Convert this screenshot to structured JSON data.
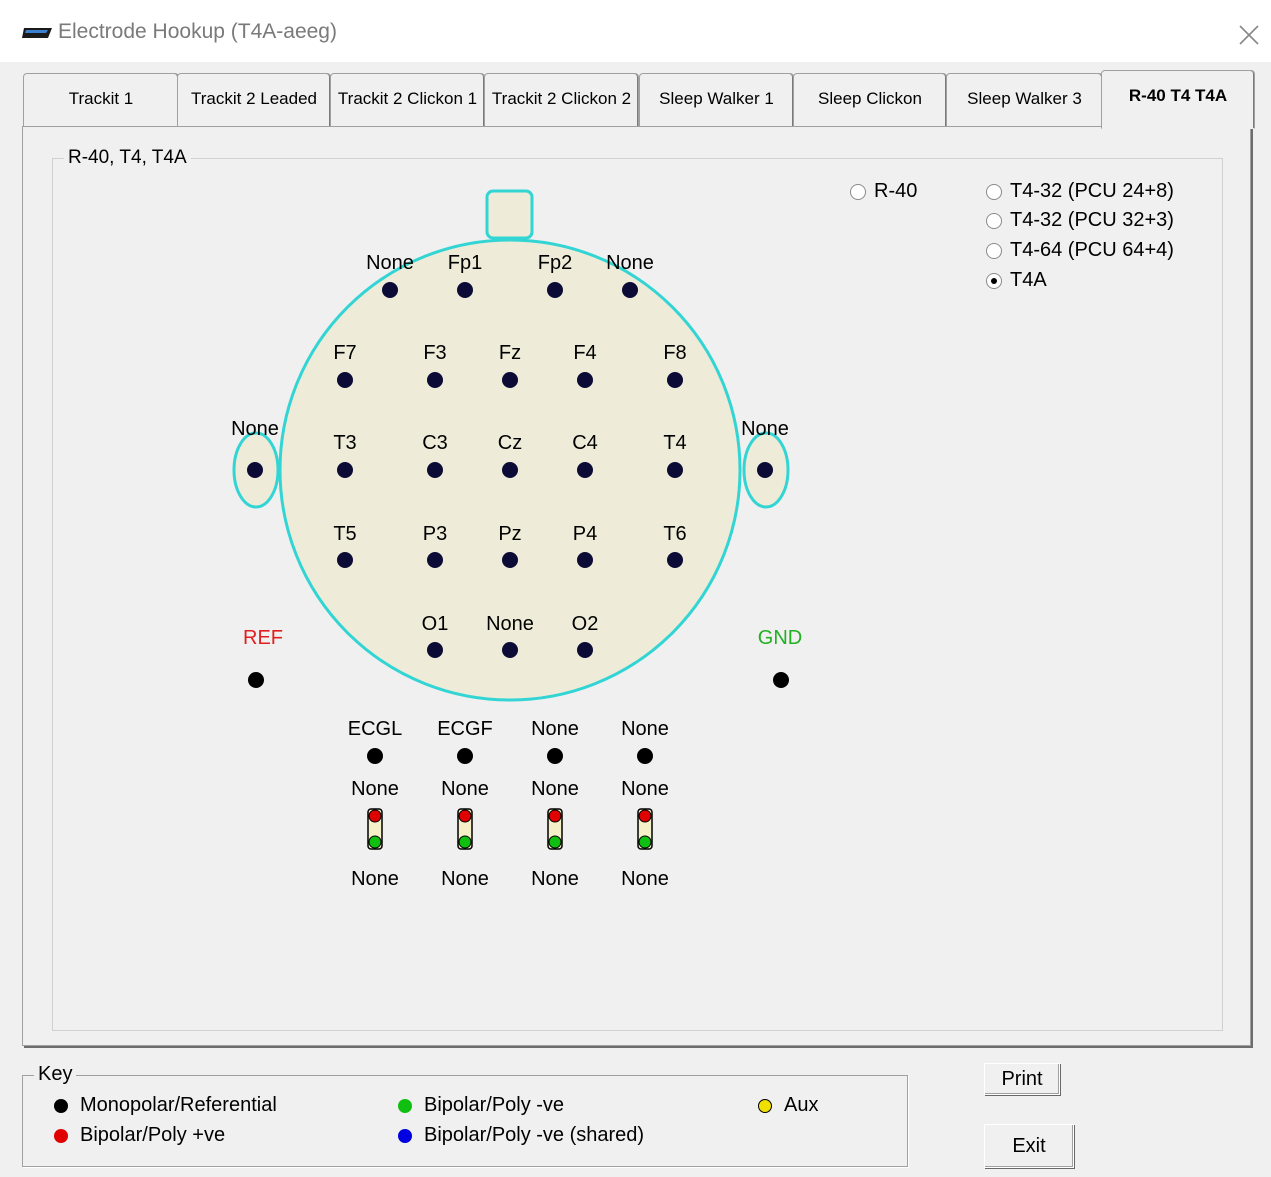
{
  "window": {
    "title": "Electrode Hookup (T4A-aeeg)",
    "icon": "device-icon",
    "close_icon": "close-icon"
  },
  "tabs": [
    {
      "label": "Trackit 1"
    },
    {
      "label": "Trackit 2 Leaded"
    },
    {
      "label": "Trackit 2 Clickon 1"
    },
    {
      "label": "Trackit 2 Clickon 2"
    },
    {
      "label": "Sleep Walker 1"
    },
    {
      "label": "Sleep Clickon"
    },
    {
      "label": "Sleep Walker 3"
    },
    {
      "label": "R-40 T4 T4A",
      "active": true
    }
  ],
  "group": {
    "title": "R-40, T4, T4A"
  },
  "options": [
    {
      "label": "R-40",
      "selected": false
    },
    {
      "label": "T4-32 (PCU 24+8)",
      "selected": false
    },
    {
      "label": "T4-32 (PCU 32+3)",
      "selected": false
    },
    {
      "label": "T4-64 (PCU 64+4)",
      "selected": false
    },
    {
      "label": "T4A",
      "selected": true
    }
  ],
  "electrodes": {
    "row1": [
      "None",
      "Fp1",
      "Fp2",
      "None"
    ],
    "row2": [
      "F7",
      "F3",
      "Fz",
      "F4",
      "F8"
    ],
    "row3": [
      "None",
      "T3",
      "C3",
      "Cz",
      "C4",
      "T4",
      "None"
    ],
    "row4": [
      "T5",
      "P3",
      "Pz",
      "P4",
      "T6"
    ],
    "row5": [
      "O1",
      "None",
      "O2"
    ],
    "ref": "REF",
    "gnd": "GND"
  },
  "aux_channels": {
    "top_labels": [
      "ECGL",
      "ECGF",
      "None",
      "None"
    ],
    "mid_labels": [
      "None",
      "None",
      "None",
      "None"
    ],
    "bottom_labels": [
      "None",
      "None",
      "None",
      "None"
    ]
  },
  "colors": {
    "head_fill": "#eeecd9",
    "head_outline": "#33d4d4",
    "ref": "#e02020",
    "gnd": "#22b022",
    "monopolar": "#000000",
    "bipolar_pos": "#e00000",
    "bipolar_neg": "#10c010",
    "bipolar_shared": "#0000e0",
    "aux": "#f0e000"
  },
  "key": {
    "title": "Key",
    "items": [
      {
        "label": "Monopolar/Referential",
        "color": "#000000"
      },
      {
        "label": "Bipolar/Poly +ve",
        "color": "#e00000"
      },
      {
        "label": "Bipolar/Poly -ve",
        "color": "#10c010"
      },
      {
        "label": "Bipolar/Poly -ve (shared)",
        "color": "#0000e0"
      },
      {
        "label": "Aux",
        "color": "#f0e000"
      }
    ]
  },
  "buttons": {
    "print": "Print",
    "exit": "Exit"
  }
}
